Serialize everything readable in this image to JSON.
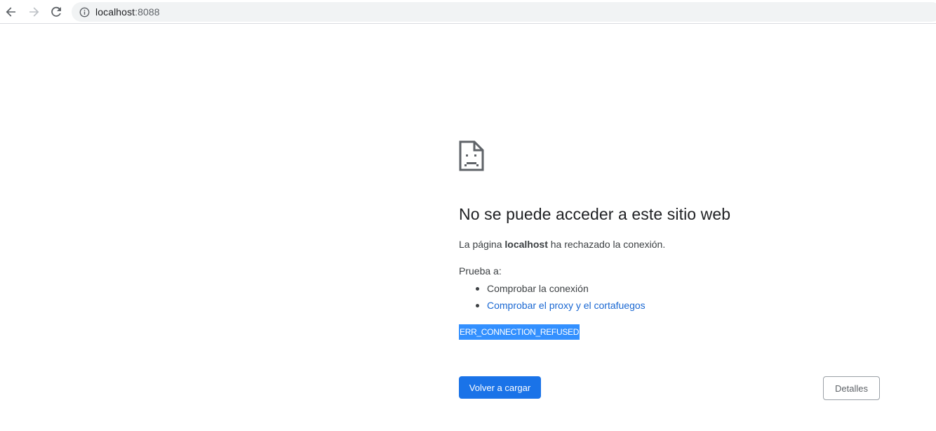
{
  "browser": {
    "url_host": "localhost",
    "url_port": ":8088",
    "icons": {
      "back": "back-arrow-icon",
      "forward": "forward-arrow-icon",
      "reload": "reload-icon",
      "site_info": "info-icon"
    }
  },
  "error_page": {
    "icon": "sad-document-icon",
    "title": "No se puede acceder a este sitio web",
    "desc_prefix": "La página ",
    "desc_host": "localhost",
    "desc_suffix": " ha rechazado la conexión.",
    "try_label": "Prueba a:",
    "suggestions": [
      "Comprobar la conexión",
      "Comprobar el proxy y el cortafuegos"
    ],
    "error_code": "ERR_CONNECTION_REFUSED",
    "reload_label": "Volver a cargar",
    "details_label": "Detalles"
  },
  "colors": {
    "primary_button": "#1a73e8",
    "link": "#1967d2",
    "selection": "#3390ff"
  }
}
